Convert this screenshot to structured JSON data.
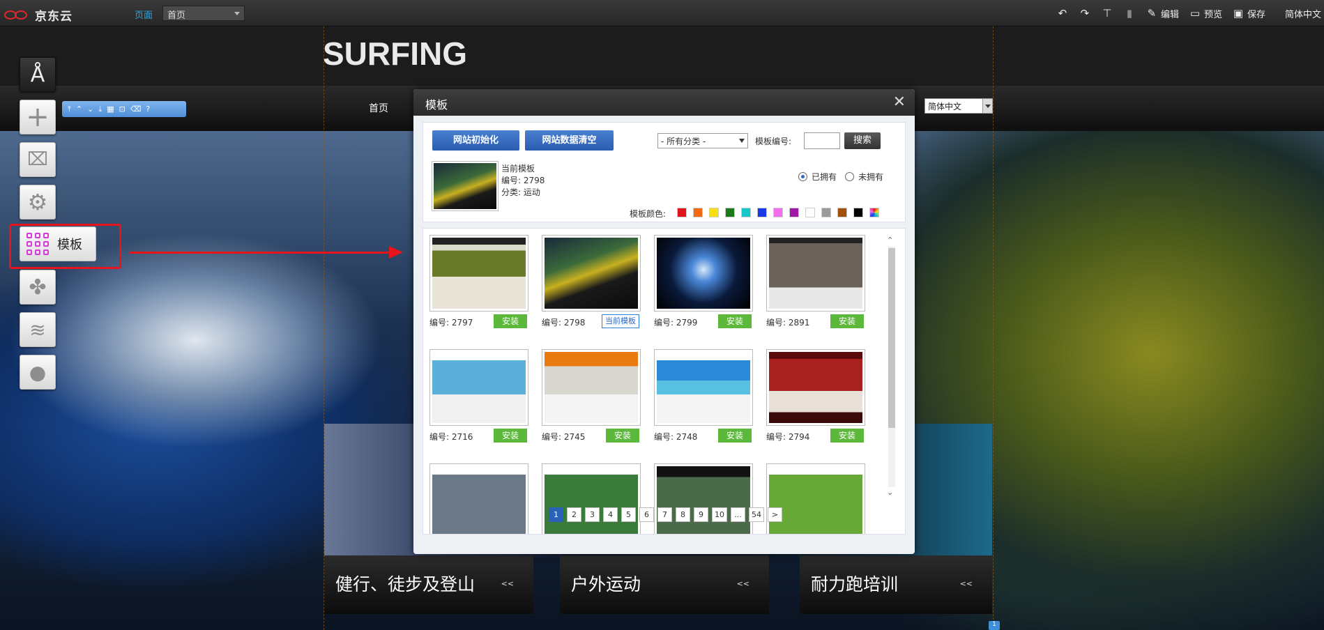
{
  "topbar": {
    "brand": "京东云",
    "page_label": "页面",
    "page_select": "首页",
    "edit": "编辑",
    "preview": "预览",
    "save": "保存",
    "language": "简体中文"
  },
  "site": {
    "title": "SURFING",
    "nav_home": "首页",
    "language_select": "简体中文",
    "categories": [
      "健行、徒步及登山",
      "户外运动",
      "耐力跑培训"
    ],
    "category_chevron": "<<",
    "badge": "1"
  },
  "sidebar": {
    "template_label": "模板"
  },
  "modal": {
    "title": "模板",
    "init_button": "网站初始化",
    "clear_button": "网站数据清空",
    "category_select": "- 所有分类 -",
    "code_label": "模板编号:",
    "search_button": "搜索",
    "current_title": "当前模板",
    "current_code": "编号: 2798",
    "current_category": "分类: 运动",
    "owned": "已拥有",
    "not_owned": "未拥有",
    "colors_label": "模板颜色:",
    "colors": [
      "#e0141c",
      "#f26a10",
      "#f8e010",
      "#1a7a1a",
      "#18c8c8",
      "#1a3ae8",
      "#f070f0",
      "#a018a8",
      "#ffffff",
      "#9a9a9a",
      "#a0520c",
      "#000000",
      "multi"
    ],
    "templates": [
      {
        "code": "编号: 2797",
        "action": "安装",
        "current": false
      },
      {
        "code": "编号: 2798",
        "action": "当前模板",
        "current": true
      },
      {
        "code": "编号: 2799",
        "action": "安装",
        "current": false
      },
      {
        "code": "编号: 2891",
        "action": "安装",
        "current": false
      },
      {
        "code": "编号: 2716",
        "action": "安装",
        "current": false
      },
      {
        "code": "编号: 2745",
        "action": "安装",
        "current": false
      },
      {
        "code": "编号: 2748",
        "action": "安装",
        "current": false
      },
      {
        "code": "编号: 2794",
        "action": "安装",
        "current": false
      }
    ],
    "pages": [
      "1",
      "2",
      "3",
      "4",
      "5",
      "6",
      "7",
      "8",
      "9",
      "10",
      "...",
      "54",
      ">"
    ],
    "active_page": "1"
  }
}
